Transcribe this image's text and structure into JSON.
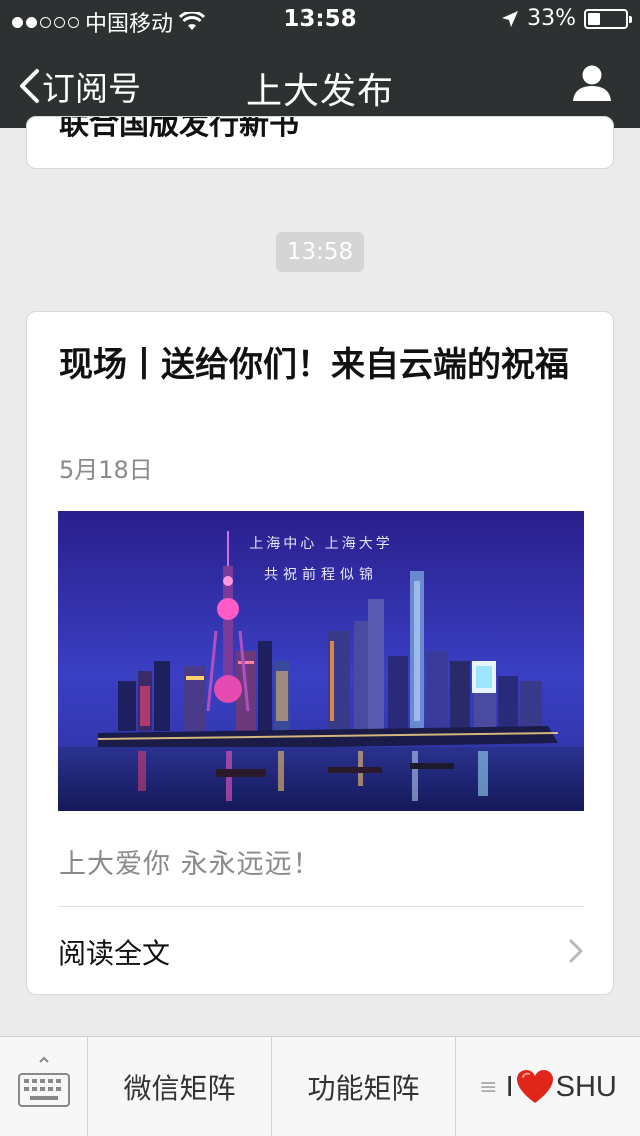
{
  "status_bar": {
    "carrier": "中国移动",
    "time": "13:58",
    "battery": "33%",
    "battery_level": 0.33
  },
  "nav": {
    "back_label": "订阅号",
    "title": "上大发布"
  },
  "feed": {
    "previous_card_text": "联合国版发行新书",
    "timestamp": "13:58",
    "article": {
      "title": "现场丨送给你们！来自云端的祝福",
      "date": "5月18日",
      "image_caption_line1": "上海中心 上海大学",
      "image_caption_line2": "共祝前程似锦",
      "summary": "上大爱你  永永远远！",
      "read_more": "阅读全文"
    }
  },
  "bottom_menu": {
    "items": [
      {
        "label": "微信矩阵"
      },
      {
        "label": "功能矩阵"
      },
      {
        "label_prefix": "I",
        "label_suffix": "SHU"
      }
    ],
    "heart_color": "#e0251b"
  },
  "colors": {
    "header_bg": "#2e3132",
    "page_bg": "#ebebeb"
  }
}
